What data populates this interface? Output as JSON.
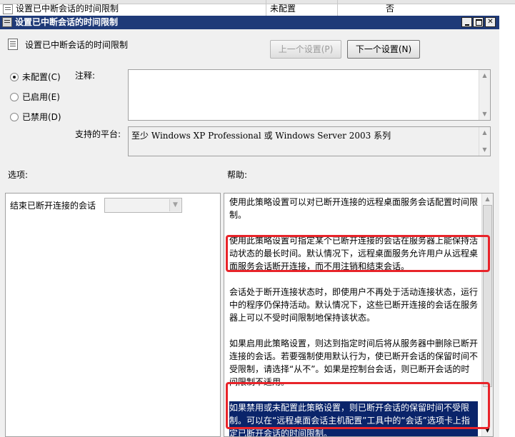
{
  "list": {
    "row_name": "设置已中断会话的时间限制",
    "row_state": "未配置",
    "row_comment": "否"
  },
  "window": {
    "title": "设置已中断会话的时间限制"
  },
  "policy_name": "设置已中断会话的时间限制",
  "nav": {
    "prev_label": "上一个设置(P)",
    "next_label": "下一个设置(N)"
  },
  "radios": [
    {
      "label": "未配置(C)",
      "selected": true
    },
    {
      "label": "已启用(E)",
      "selected": false
    },
    {
      "label": "已禁用(D)",
      "selected": false
    }
  ],
  "comment_label": "注释:",
  "platform_label": "支持的平台:",
  "platform_value": "至少 Windows XP Professional 或 Windows Server 2003 系列",
  "options_label": "选项:",
  "help_label": "帮助:",
  "option_item_label": "结束已断开连接的会话",
  "help_paragraphs": [
    "使用此策略设置可以对已断开连接的远程桌面服务会话配置时间限制。",
    "使用此策略设置可指定某个已断开连接的会话在服务器上能保持活动状态的最长时间。默认情况下，远程桌面服务允许用户从远程桌面服务会话断开连接，而不用注销和结束会话。",
    "会话处于断开连接状态时，即使用户不再处于活动连接状态，运行中的程序仍保持活动。默认情况下，这些已断开连接的会话在服务器上可以不受时间限制地保持该状态。",
    "如果启用此策略设置，则达到指定时间后将从服务器中删除已断开连接的会话。若要强制使用默认行为，使已断开会话的保留时间不受限制，请选择“从不”。如果是控制台会话，则已断开会话的时间限制不适用。",
    "如果禁用或未配置此策略设置，则已断开会话的保留时间不受限制。可以在“远程桌面会话主机配置”工具中的“会话”选项卡上指定已断开会话的时间限制。"
  ],
  "colors": {
    "titlebar": "#1f3a78",
    "selection": "#0a246a",
    "annotation": "#e8242a"
  }
}
